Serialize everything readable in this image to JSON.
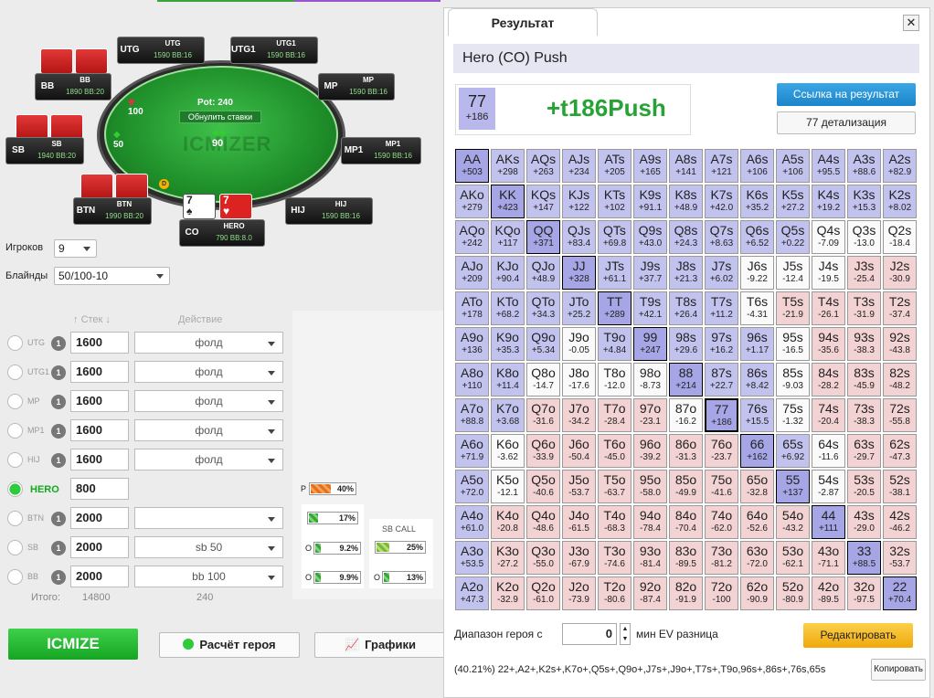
{
  "table": {
    "watermark": "ICMIZER",
    "pot": "Pot: 240",
    "reset_label": "Обнулить ставки",
    "chips": {
      "utg": "100",
      "sb": "50",
      "hero": "90"
    },
    "dealer": "D",
    "seats": [
      {
        "key": "utg",
        "pos": "UTG",
        "name": "UTG",
        "stack": "1590 BB:16"
      },
      {
        "key": "utg1",
        "pos": "UTG1",
        "name": "UTG1",
        "stack": "1590 BB:16"
      },
      {
        "key": "mp",
        "pos": "MP",
        "name": "MP",
        "stack": "1590 BB:16"
      },
      {
        "key": "mp1",
        "pos": "MP1",
        "name": "MP1",
        "stack": "1590 BB:16"
      },
      {
        "key": "hij",
        "pos": "HIJ",
        "name": "HIJ",
        "stack": "1590 BB:16"
      },
      {
        "key": "hero",
        "pos": "CO",
        "name": "HERO",
        "stack": "790 BB:8.0"
      },
      {
        "key": "btn",
        "pos": "BTN",
        "name": "BTN",
        "stack": "1990 BB:20"
      },
      {
        "key": "sb",
        "pos": "SB",
        "name": "SB",
        "stack": "1940 BB:20"
      },
      {
        "key": "bb",
        "pos": "BB",
        "name": "BB",
        "stack": "1890 BB:20"
      }
    ],
    "hero_cards": [
      {
        "rank": "7",
        "suit": "♠",
        "color": "#222"
      },
      {
        "rank": "7",
        "suit": "♥",
        "color": "#d22"
      }
    ]
  },
  "settings": {
    "players_label": "Игроков",
    "players_value": "9",
    "blinds_label": "Блайнды",
    "blinds_value": "50/100-10"
  },
  "players_table": {
    "stack_header": "Стек",
    "action_header": "Действие",
    "total_label": "Итого:",
    "total_stack": "14800",
    "total_action": "240",
    "rows": [
      {
        "name": "UTG",
        "count": "1",
        "stack": "1600",
        "action": "фолд",
        "selected": false
      },
      {
        "name": "UTG1",
        "count": "1",
        "stack": "1600",
        "action": "фолд",
        "selected": false
      },
      {
        "name": "MP",
        "count": "1",
        "stack": "1600",
        "action": "фолд",
        "selected": false
      },
      {
        "name": "MP1",
        "count": "1",
        "stack": "1600",
        "action": "фолд",
        "selected": false
      },
      {
        "name": "HIJ",
        "count": "1",
        "stack": "1600",
        "action": "фолд",
        "selected": false
      },
      {
        "name": "HERO",
        "count": "",
        "stack": "800",
        "action": "",
        "selected": true
      },
      {
        "name": "BTN",
        "count": "1",
        "stack": "2000",
        "action": "",
        "selected": false
      },
      {
        "name": "SB",
        "count": "1",
        "stack": "2000",
        "action": "sb 50",
        "selected": false
      },
      {
        "name": "BB",
        "count": "1",
        "stack": "2000",
        "action": "bb 100",
        "selected": false
      }
    ]
  },
  "stats": {
    "p_label": "P",
    "p_value": "40%",
    "b1": "17%",
    "o1_label": "O",
    "o1": "9.2%",
    "o2_label": "O",
    "o2": "9.9%",
    "sbcall_label": "SB CALL",
    "sb1": "25%",
    "sb2_label": "O",
    "sb2": "13%"
  },
  "buttons": {
    "icmize": "ICMIZE",
    "hero_calc": "Расчёт героя",
    "charts": "Графики"
  },
  "modal": {
    "tab": "Результат",
    "close": "✕",
    "title": "Hero (CO) Push",
    "hand": "77",
    "hand_ev": "+186",
    "result_text": "+t186Push",
    "link_button": "Ссылка на результат",
    "detail_button": "77 детализация",
    "range_label": "Диапазон героя с",
    "range_value": "0",
    "range_suffix": "мин EV разница",
    "edit_button": "Редактировать",
    "range_text": "(40.21%) 22+,A2+,K2s+,K7o+,Q5s+,Q9o+,J7s+,J9o+,T7s+,T9o,96s+,86s+,76s,65s",
    "copy_button": "Копировать",
    "grid": [
      [
        [
          "AA",
          "+503"
        ],
        [
          "AKs",
          "+298"
        ],
        [
          "AQs",
          "+263"
        ],
        [
          "AJs",
          "+234"
        ],
        [
          "ATs",
          "+205"
        ],
        [
          "A9s",
          "+165"
        ],
        [
          "A8s",
          "+141"
        ],
        [
          "A7s",
          "+121"
        ],
        [
          "A6s",
          "+106"
        ],
        [
          "A5s",
          "+106"
        ],
        [
          "A4s",
          "+95.5"
        ],
        [
          "A3s",
          "+88.6"
        ],
        [
          "A2s",
          "+82.9"
        ]
      ],
      [
        [
          "AKo",
          "+279"
        ],
        [
          "KK",
          "+423"
        ],
        [
          "KQs",
          "+147"
        ],
        [
          "KJs",
          "+122"
        ],
        [
          "KTs",
          "+102"
        ],
        [
          "K9s",
          "+91.1"
        ],
        [
          "K8s",
          "+48.9"
        ],
        [
          "K7s",
          "+42.0"
        ],
        [
          "K6s",
          "+35.2"
        ],
        [
          "K5s",
          "+27.2"
        ],
        [
          "K4s",
          "+19.2"
        ],
        [
          "K3s",
          "+15.3"
        ],
        [
          "K2s",
          "+8.02"
        ]
      ],
      [
        [
          "AQo",
          "+242"
        ],
        [
          "KQo",
          "+117"
        ],
        [
          "QQ",
          "+371"
        ],
        [
          "QJs",
          "+83.4"
        ],
        [
          "QTs",
          "+69.8"
        ],
        [
          "Q9s",
          "+43.0"
        ],
        [
          "Q8s",
          "+24.3"
        ],
        [
          "Q7s",
          "+8.63"
        ],
        [
          "Q6s",
          "+6.52"
        ],
        [
          "Q5s",
          "+0.22"
        ],
        [
          "Q4s",
          "-7.09"
        ],
        [
          "Q3s",
          "-13.0"
        ],
        [
          "Q2s",
          "-18.4"
        ]
      ],
      [
        [
          "AJo",
          "+209"
        ],
        [
          "KJo",
          "+90.4"
        ],
        [
          "QJo",
          "+48.9"
        ],
        [
          "JJ",
          "+328"
        ],
        [
          "JTs",
          "+61.1"
        ],
        [
          "J9s",
          "+37.7"
        ],
        [
          "J8s",
          "+21.3"
        ],
        [
          "J7s",
          "+6.02"
        ],
        [
          "J6s",
          "-9.22"
        ],
        [
          "J5s",
          "-12.4"
        ],
        [
          "J4s",
          "-19.5"
        ],
        [
          "J3s",
          "-25.4"
        ],
        [
          "J2s",
          "-30.9"
        ]
      ],
      [
        [
          "ATo",
          "+178"
        ],
        [
          "KTo",
          "+68.2"
        ],
        [
          "QTo",
          "+34.3"
        ],
        [
          "JTo",
          "+25.2"
        ],
        [
          "TT",
          "+289"
        ],
        [
          "T9s",
          "+42.1"
        ],
        [
          "T8s",
          "+26.4"
        ],
        [
          "T7s",
          "+11.2"
        ],
        [
          "T6s",
          "-4.31"
        ],
        [
          "T5s",
          "-21.9"
        ],
        [
          "T4s",
          "-26.1"
        ],
        [
          "T3s",
          "-31.9"
        ],
        [
          "T2s",
          "-37.4"
        ]
      ],
      [
        [
          "A9o",
          "+136"
        ],
        [
          "K9o",
          "+35.3"
        ],
        [
          "Q9o",
          "+5.34"
        ],
        [
          "J9o",
          "-0.05"
        ],
        [
          "T9o",
          "+4.84"
        ],
        [
          "99",
          "+247"
        ],
        [
          "98s",
          "+29.6"
        ],
        [
          "97s",
          "+16.2"
        ],
        [
          "96s",
          "+1.17"
        ],
        [
          "95s",
          "-16.5"
        ],
        [
          "94s",
          "-35.6"
        ],
        [
          "93s",
          "-38.3"
        ],
        [
          "92s",
          "-43.8"
        ]
      ],
      [
        [
          "A8o",
          "+110"
        ],
        [
          "K8o",
          "+11.4"
        ],
        [
          "Q8o",
          "-14.7"
        ],
        [
          "J8o",
          "-17.6"
        ],
        [
          "T8o",
          "-12.0"
        ],
        [
          "98o",
          "-8.73"
        ],
        [
          "88",
          "+214"
        ],
        [
          "87s",
          "+22.7"
        ],
        [
          "86s",
          "+8.42"
        ],
        [
          "85s",
          "-9.03"
        ],
        [
          "84s",
          "-28.2"
        ],
        [
          "83s",
          "-45.9"
        ],
        [
          "82s",
          "-48.2"
        ]
      ],
      [
        [
          "A7o",
          "+88.8"
        ],
        [
          "K7o",
          "+3.68"
        ],
        [
          "Q7o",
          "-31.6"
        ],
        [
          "J7o",
          "-34.2"
        ],
        [
          "T7o",
          "-28.4"
        ],
        [
          "97o",
          "-23.1"
        ],
        [
          "87o",
          "-16.2"
        ],
        [
          "77",
          "+186"
        ],
        [
          "76s",
          "+15.5"
        ],
        [
          "75s",
          "-1.32"
        ],
        [
          "74s",
          "-20.4"
        ],
        [
          "73s",
          "-38.3"
        ],
        [
          "72s",
          "-55.8"
        ]
      ],
      [
        [
          "A6o",
          "+71.9"
        ],
        [
          "K6o",
          "-3.62"
        ],
        [
          "Q6o",
          "-33.9"
        ],
        [
          "J6o",
          "-50.4"
        ],
        [
          "T6o",
          "-45.0"
        ],
        [
          "96o",
          "-39.2"
        ],
        [
          "86o",
          "-31.3"
        ],
        [
          "76o",
          "-23.7"
        ],
        [
          "66",
          "+162"
        ],
        [
          "65s",
          "+6.92"
        ],
        [
          "64s",
          "-11.6"
        ],
        [
          "63s",
          "-29.7"
        ],
        [
          "62s",
          "-47.3"
        ]
      ],
      [
        [
          "A5o",
          "+72.0"
        ],
        [
          "K5o",
          "-12.1"
        ],
        [
          "Q5o",
          "-40.6"
        ],
        [
          "J5o",
          "-53.7"
        ],
        [
          "T5o",
          "-63.7"
        ],
        [
          "95o",
          "-58.0"
        ],
        [
          "85o",
          "-49.9"
        ],
        [
          "75o",
          "-41.6"
        ],
        [
          "65o",
          "-32.8"
        ],
        [
          "55",
          "+137"
        ],
        [
          "54s",
          "-2.87"
        ],
        [
          "53s",
          "-20.5"
        ],
        [
          "52s",
          "-38.1"
        ]
      ],
      [
        [
          "A4o",
          "+61.0"
        ],
        [
          "K4o",
          "-20.8"
        ],
        [
          "Q4o",
          "-48.6"
        ],
        [
          "J4o",
          "-61.5"
        ],
        [
          "T4o",
          "-68.3"
        ],
        [
          "94o",
          "-78.4"
        ],
        [
          "84o",
          "-70.4"
        ],
        [
          "74o",
          "-62.0"
        ],
        [
          "64o",
          "-52.6"
        ],
        [
          "54o",
          "-43.2"
        ],
        [
          "44",
          "+111"
        ],
        [
          "43s",
          "-29.0"
        ],
        [
          "42s",
          "-46.2"
        ]
      ],
      [
        [
          "A3o",
          "+53.5"
        ],
        [
          "K3o",
          "-27.2"
        ],
        [
          "Q3o",
          "-55.0"
        ],
        [
          "J3o",
          "-67.9"
        ],
        [
          "T3o",
          "-74.6"
        ],
        [
          "93o",
          "-81.4"
        ],
        [
          "83o",
          "-89.5"
        ],
        [
          "73o",
          "-81.2"
        ],
        [
          "63o",
          "-72.0"
        ],
        [
          "53o",
          "-62.1"
        ],
        [
          "43o",
          "-71.1"
        ],
        [
          "33",
          "+88.5"
        ],
        [
          "32s",
          "-53.7"
        ]
      ],
      [
        [
          "A2o",
          "+47.3"
        ],
        [
          "K2o",
          "-32.9"
        ],
        [
          "Q2o",
          "-61.0"
        ],
        [
          "J2o",
          "-73.9"
        ],
        [
          "T2o",
          "-80.6"
        ],
        [
          "92o",
          "-87.4"
        ],
        [
          "82o",
          "-91.9"
        ],
        [
          "72o",
          "-100"
        ],
        [
          "62o",
          "-90.9"
        ],
        [
          "52o",
          "-80.9"
        ],
        [
          "42o",
          "-89.5"
        ],
        [
          "32o",
          "-97.5"
        ],
        [
          "22",
          "+70.4"
        ]
      ]
    ]
  }
}
